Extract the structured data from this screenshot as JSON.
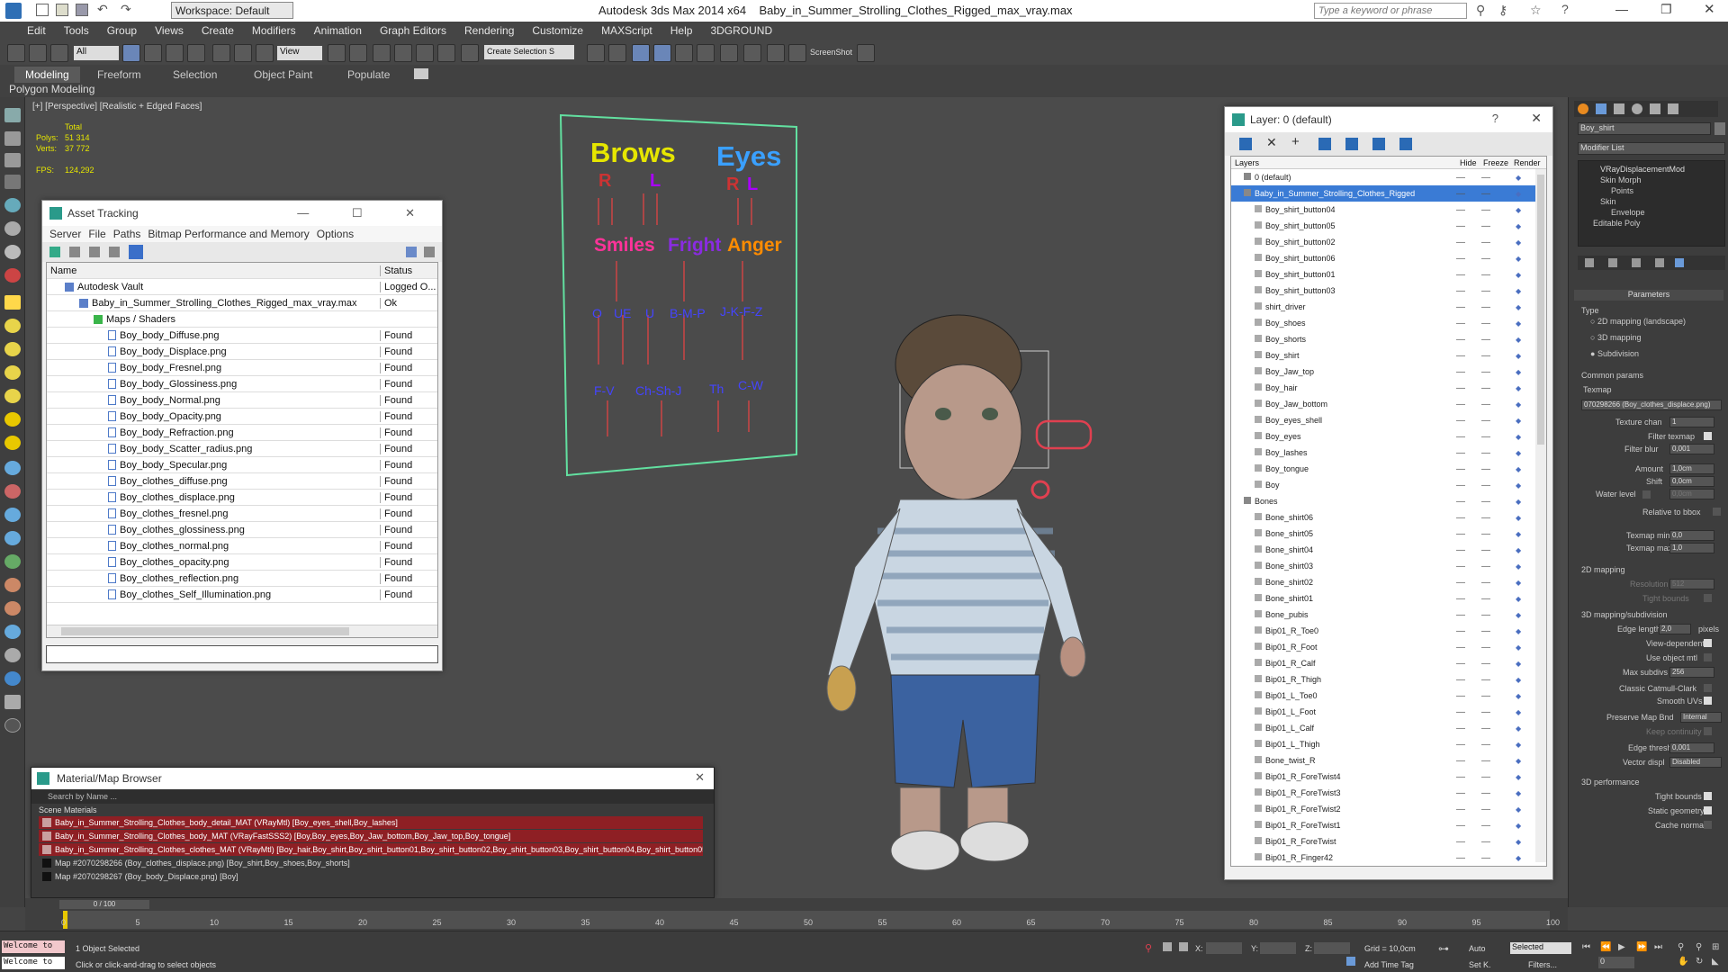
{
  "app": {
    "title": "Autodesk 3ds Max  2014 x64",
    "file": "Baby_in_Summer_Strolling_Clothes_Rigged_max_vray.max",
    "workspace": "Workspace: Default",
    "search_placeholder": "Type a keyword or phrase"
  },
  "menus": [
    "Edit",
    "Tools",
    "Group",
    "Views",
    "Create",
    "Modifiers",
    "Animation",
    "Graph Editors",
    "Rendering",
    "Customize",
    "MAXScript",
    "Help",
    "3DGROUND"
  ],
  "toolbar": {
    "filter": "All",
    "refcoord": "View",
    "selset": "Create Selection S",
    "screenshot": "ScreenShot"
  },
  "ribbon": {
    "tabs": [
      "Modeling",
      "Freeform",
      "Selection",
      "Object Paint",
      "Populate"
    ],
    "sub": "Polygon Modeling"
  },
  "viewport": {
    "label": "[+] [Perspective] [Realistic + Edged Faces]",
    "stats_title": "Total",
    "polys_label": "Polys:",
    "polys": "51 314",
    "verts_label": "Verts:",
    "verts": "37 772",
    "fps_label": "FPS:",
    "fps": "124,292",
    "face": {
      "brows": "Brows",
      "eyes": "Eyes",
      "r": "R",
      "l": "L",
      "r2": "R",
      "l2": "L",
      "smiles": "Smiles",
      "fright": "Fright",
      "anger": "Anger",
      "row3": [
        "O",
        "UE",
        "U",
        "B-M-P",
        "J-K-F-Z"
      ],
      "row4": [
        "F-V",
        "Ch-Sh-J",
        "Th",
        "C-W"
      ]
    }
  },
  "asset_tracking": {
    "title": "Asset Tracking",
    "menu": [
      "Server",
      "File",
      "Paths",
      "Bitmap Performance and Memory",
      "Options"
    ],
    "col_name": "Name",
    "col_status": "Status",
    "rows": [
      {
        "name": "Autodesk Vault",
        "status": "Logged O...",
        "indent": 0
      },
      {
        "name": "Baby_in_Summer_Strolling_Clothes_Rigged_max_vray.max",
        "status": "Ok",
        "indent": 1
      },
      {
        "name": "Maps / Shaders",
        "status": "",
        "indent": 2
      },
      {
        "name": "Boy_body_Diffuse.png",
        "status": "Found",
        "indent": 3
      },
      {
        "name": "Boy_body_Displace.png",
        "status": "Found",
        "indent": 3
      },
      {
        "name": "Boy_body_Fresnel.png",
        "status": "Found",
        "indent": 3
      },
      {
        "name": "Boy_body_Glossiness.png",
        "status": "Found",
        "indent": 3
      },
      {
        "name": "Boy_body_Normal.png",
        "status": "Found",
        "indent": 3
      },
      {
        "name": "Boy_body_Opacity.png",
        "status": "Found",
        "indent": 3
      },
      {
        "name": "Boy_body_Refraction.png",
        "status": "Found",
        "indent": 3
      },
      {
        "name": "Boy_body_Scatter_radius.png",
        "status": "Found",
        "indent": 3
      },
      {
        "name": "Boy_body_Specular.png",
        "status": "Found",
        "indent": 3
      },
      {
        "name": "Boy_clothes_diffuse.png",
        "status": "Found",
        "indent": 3
      },
      {
        "name": "Boy_clothes_displace.png",
        "status": "Found",
        "indent": 3
      },
      {
        "name": "Boy_clothes_fresnel.png",
        "status": "Found",
        "indent": 3
      },
      {
        "name": "Boy_clothes_glossiness.png",
        "status": "Found",
        "indent": 3
      },
      {
        "name": "Boy_clothes_normal.png",
        "status": "Found",
        "indent": 3
      },
      {
        "name": "Boy_clothes_opacity.png",
        "status": "Found",
        "indent": 3
      },
      {
        "name": "Boy_clothes_reflection.png",
        "status": "Found",
        "indent": 3
      },
      {
        "name": "Boy_clothes_Self_Illumination.png",
        "status": "Found",
        "indent": 3
      }
    ]
  },
  "material_browser": {
    "title": "Material/Map Browser",
    "search": "Search by Name ...",
    "group": "Scene Materials",
    "items": [
      "Baby_in_Summer_Strolling_Clothes_body_detail_MAT (VRayMtl) [Boy_eyes_shell,Boy_lashes]",
      "Baby_in_Summer_Strolling_Clothes_body_MAT (VRayFastSSS2) [Boy,Boy_eyes,Boy_Jaw_bottom,Boy_Jaw_top,Boy_tongue]",
      "Baby_in_Summer_Strolling_Clothes_clothes_MAT (VRayMtl) [Boy_hair,Boy_shirt,Boy_shirt_button01,Boy_shirt_button02,Boy_shirt_button03,Boy_shirt_button04,Boy_shirt_button05...",
      "Map #2070298266 (Boy_clothes_displace.png) [Boy_shirt,Boy_shoes,Boy_shorts]",
      "Map #2070298267 (Boy_body_Displace.png) [Boy]"
    ]
  },
  "layers": {
    "title": "Layer: 0 (default)",
    "col_layers": "Layers",
    "col_hide": "Hide",
    "col_freeze": "Freeze",
    "col_render": "Render",
    "items": [
      "0 (default)",
      "Baby_in_Summer_Strolling_Clothes_Rigged",
      "Boy_shirt_button04",
      "Boy_shirt_button05",
      "Boy_shirt_button02",
      "Boy_shirt_button06",
      "Boy_shirt_button01",
      "Boy_shirt_button03",
      "shirt_driver",
      "Boy_shoes",
      "Boy_shorts",
      "Boy_shirt",
      "Boy_Jaw_top",
      "Boy_hair",
      "Boy_Jaw_bottom",
      "Boy_eyes_shell",
      "Boy_eyes",
      "Boy_lashes",
      "Boy_tongue",
      "Boy",
      "Bones",
      "Bone_shirt06",
      "Bone_shirt05",
      "Bone_shirt04",
      "Bone_shirt03",
      "Bone_shirt02",
      "Bone_shirt01",
      "Bone_pubis",
      "Bip01_R_Toe0",
      "Bip01_R_Foot",
      "Bip01_R_Calf",
      "Bip01_R_Thigh",
      "Bip01_L_Toe0",
      "Bip01_L_Foot",
      "Bip01_L_Calf",
      "Bip01_L_Thigh",
      "Bone_twist_R",
      "Bip01_R_ForeTwist4",
      "Bip01_R_ForeTwist3",
      "Bip01_R_ForeTwist2",
      "Bip01_R_ForeTwist1",
      "Bip01_R_ForeTwist",
      "Bip01_R_Finger42"
    ]
  },
  "command_panel": {
    "object": "Boy_shirt",
    "modifier_list": "Modifier List",
    "stack": [
      "VRayDisplacementMod",
      "Skin Morph",
      "Points",
      "Skin",
      "Envelope",
      "Editable Poly"
    ],
    "parameters": "Parameters",
    "type": "Type",
    "types": [
      "2D mapping (landscape)",
      "3D mapping",
      "Subdivision"
    ],
    "common": "Common params",
    "texmap": "Texmap",
    "texmap_value": "070298266 (Boy_clothes_displace.png)",
    "texture_chan": "Texture chan",
    "texture_chan_v": "1",
    "filter_texmap": "Filter texmap",
    "filter_blur": "Filter blur",
    "filter_blur_v": "0,001",
    "amount": "Amount",
    "amount_v": "1,0cm",
    "shift": "Shift",
    "shift_v": "0,0cm",
    "water": "Water level",
    "water_v": "0,0cm",
    "rel_bbox": "Relative to bbox",
    "texmap_min": "Texmap min",
    "texmap_min_v": "0,0",
    "texmap_max": "Texmap max",
    "texmap_max_v": "1,0",
    "m2d": "2D mapping",
    "resolution": "Resolution",
    "resolution_v": "512",
    "tight": "Tight bounds",
    "m3d": "3D mapping/subdivision",
    "edge_len": "Edge length",
    "edge_len_v": "2,0",
    "pixels": "pixels",
    "view_dep": "View-dependent",
    "use_obj": "Use object mtl",
    "max_subdivs": "Max subdivs",
    "max_subdivs_v": "256",
    "catmull": "Classic Catmull-Clark",
    "smooth_uv": "Smooth UVs",
    "preserve": "Preserve Map Bnd",
    "preserve_v": "Internal",
    "keep_cont": "Keep continuity",
    "edge_thresh": "Edge thresh",
    "edge_thresh_v": "0,001",
    "vector": "Vector displ",
    "vector_v": "Disabled",
    "perf": "3D performance",
    "tight2": "Tight bounds",
    "static": "Static geometry",
    "cache": "Cache normals"
  },
  "timeline": {
    "frame": "0 / 100",
    "ticks": [
      "0",
      "5",
      "10",
      "15",
      "20",
      "25",
      "30",
      "35",
      "40",
      "45",
      "50",
      "55",
      "60",
      "65",
      "70",
      "75",
      "80",
      "85",
      "90",
      "95",
      "100"
    ]
  },
  "status": {
    "welcome": "Welcome to",
    "selected": "1 Object Selected",
    "prompt": "Click or click-and-drag to select objects",
    "x": "X:",
    "y": "Y:",
    "z": "Z:",
    "grid": "Grid = 10,0cm",
    "auto": "Auto",
    "selected_mode": "Selected",
    "setk": "Set K.",
    "filters": "Filters...",
    "add_time_tag": "Add Time Tag",
    "frame_field": "0"
  }
}
